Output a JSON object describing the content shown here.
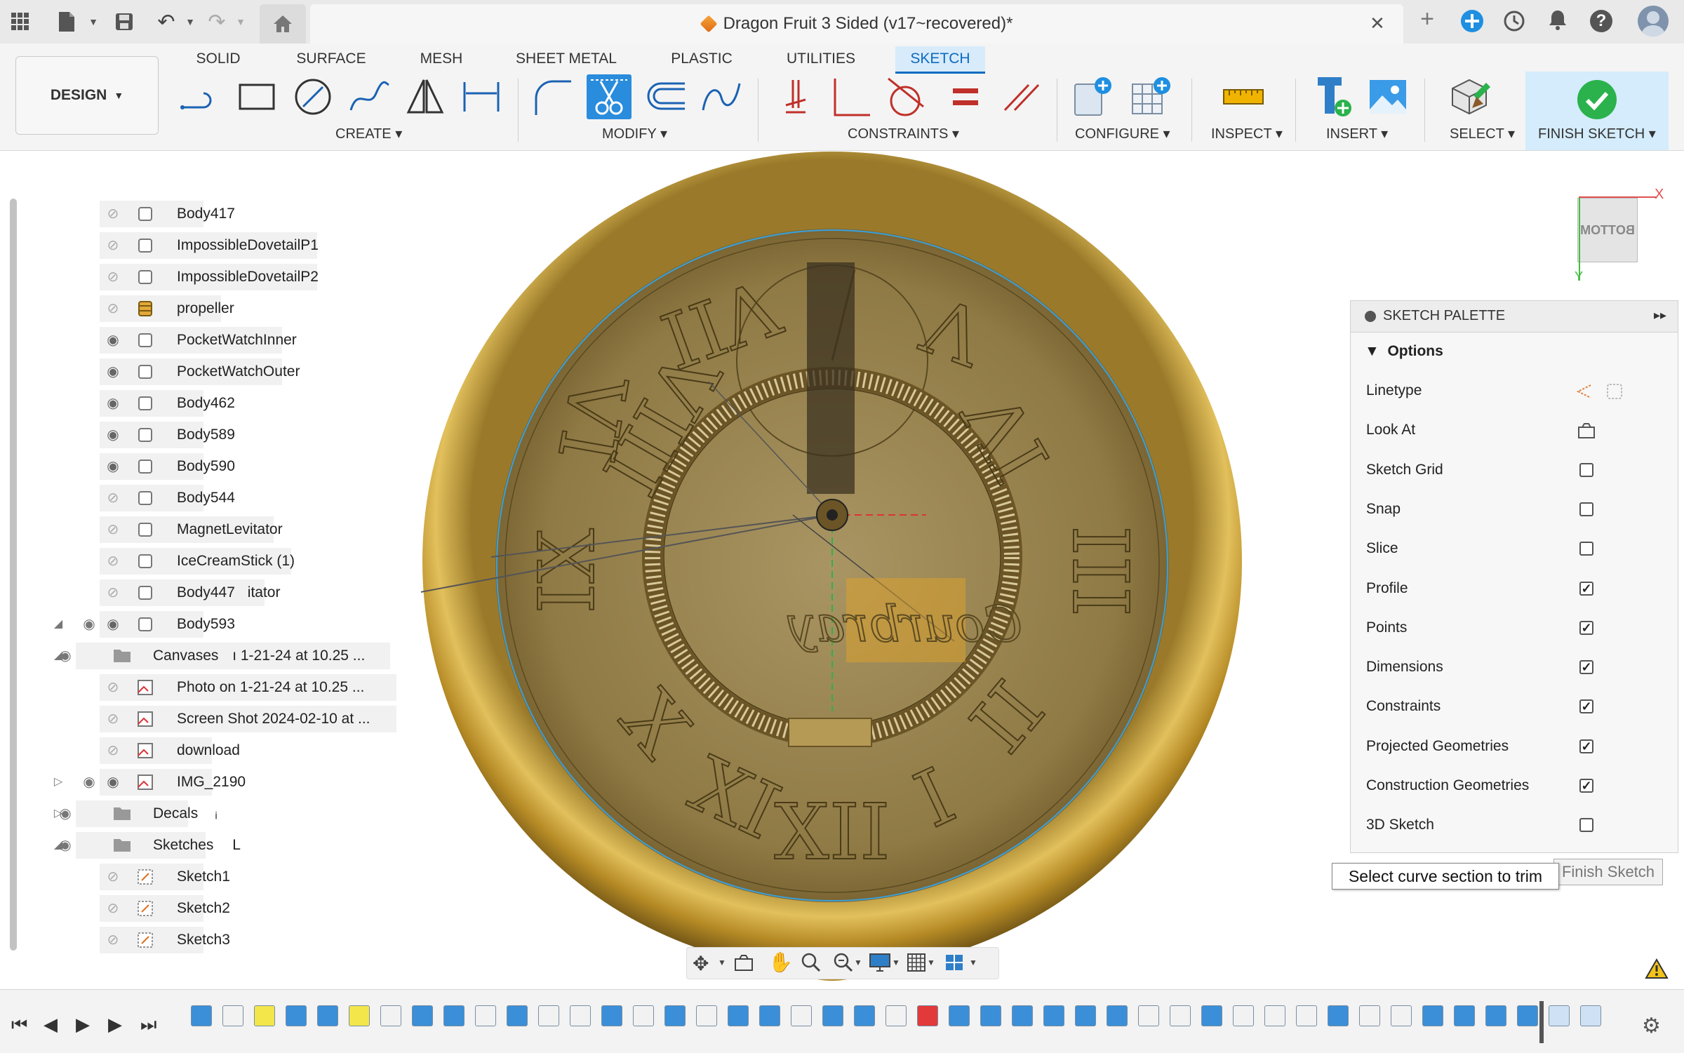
{
  "titlebar": {
    "document_title": "Dragon Fruit 3 Sided (v17~recovered)*",
    "close_tab": "✕",
    "new_tab": "+"
  },
  "toolbar": {
    "workspace": "DESIGN",
    "tabs": [
      "SOLID",
      "SURFACE",
      "MESH",
      "SHEET METAL",
      "PLASTIC",
      "UTILITIES",
      "SKETCH"
    ],
    "active_tab": "SKETCH",
    "groups": {
      "create": "CREATE",
      "modify": "MODIFY",
      "constraints": "CONSTRAINTS",
      "configure": "CONFIGURE",
      "inspect": "INSPECT",
      "insert": "INSERT",
      "select": "SELECT",
      "finish": "FINISH SKETCH"
    }
  },
  "browser": {
    "items": [
      {
        "label": "Body417",
        "visible": false,
        "type": "body"
      },
      {
        "label": "ImpossibleDovetailP1",
        "visible": false,
        "type": "body"
      },
      {
        "label": "ImpossibleDovetailP2",
        "visible": false,
        "type": "body"
      },
      {
        "label": "propeller",
        "visible": false,
        "type": "component"
      },
      {
        "label": "PocketWatchInner",
        "visible": true,
        "type": "body"
      },
      {
        "label": "PocketWatchOuter",
        "visible": true,
        "type": "body"
      },
      {
        "label": "Body462",
        "visible": true,
        "type": "body"
      },
      {
        "label": "Body589",
        "visible": true,
        "type": "body"
      },
      {
        "label": "Body590",
        "visible": true,
        "type": "body"
      },
      {
        "label": "Body544",
        "visible": false,
        "type": "body"
      },
      {
        "label": "MagnetLevitator",
        "visible": false,
        "type": "body"
      },
      {
        "label": "IceCreamStick (1)",
        "visible": false,
        "type": "body"
      },
      {
        "label": "Body447",
        "suffix": "itator",
        "visible": false,
        "type": "body"
      },
      {
        "label": "Body593",
        "visible": true,
        "type": "body"
      },
      {
        "label": "Canvases",
        "suffix": "ı 1-21-24 at 10.25 ...",
        "visible": true,
        "type": "folder"
      },
      {
        "label": "Photo on 1-21-24 at 10.25 ...",
        "visible": false,
        "type": "canvas"
      },
      {
        "label": "Screen Shot 2024-02-10 at ...",
        "visible": false,
        "type": "canvas"
      },
      {
        "label": "download",
        "visible": false,
        "type": "canvas"
      },
      {
        "label": "IMG_2190",
        "visible": true,
        "type": "canvas"
      },
      {
        "label": "Decals",
        "suffix": "ᵢ",
        "visible": true,
        "type": "folder"
      },
      {
        "label": "Sketches",
        "suffix": "L",
        "visible": true,
        "type": "folder"
      },
      {
        "label": "Sketch1",
        "visible": false,
        "type": "sketch"
      },
      {
        "label": "Sketch2",
        "visible": false,
        "type": "sketch"
      },
      {
        "label": "Sketch3",
        "visible": false,
        "type": "sketch"
      }
    ]
  },
  "viewcube": {
    "face": "BOTTOM",
    "x_axis": "X",
    "y_axis": "Y"
  },
  "palette": {
    "title": "SKETCH PALETTE",
    "section": "Options",
    "options": [
      {
        "label": "Linetype",
        "kind": "icons"
      },
      {
        "label": "Look At",
        "kind": "icon"
      },
      {
        "label": "Sketch Grid",
        "checked": false
      },
      {
        "label": "Snap",
        "checked": false
      },
      {
        "label": "Slice",
        "checked": false
      },
      {
        "label": "Profile",
        "checked": true
      },
      {
        "label": "Points",
        "checked": true
      },
      {
        "label": "Dimensions",
        "checked": true
      },
      {
        "label": "Constraints",
        "checked": true
      },
      {
        "label": "Projected Geometries",
        "checked": true
      },
      {
        "label": "Construction Geometries",
        "checked": true
      },
      {
        "label": "3D Sketch",
        "checked": false
      }
    ],
    "finish_button": "Finish Sketch"
  },
  "tooltip": "Select curve section to trim",
  "colors": {
    "accent": "#0a6bc1",
    "finish_green": "#2bb24c",
    "gold": "#c9a13b",
    "active_tab_bg": "#d8ebfb"
  }
}
